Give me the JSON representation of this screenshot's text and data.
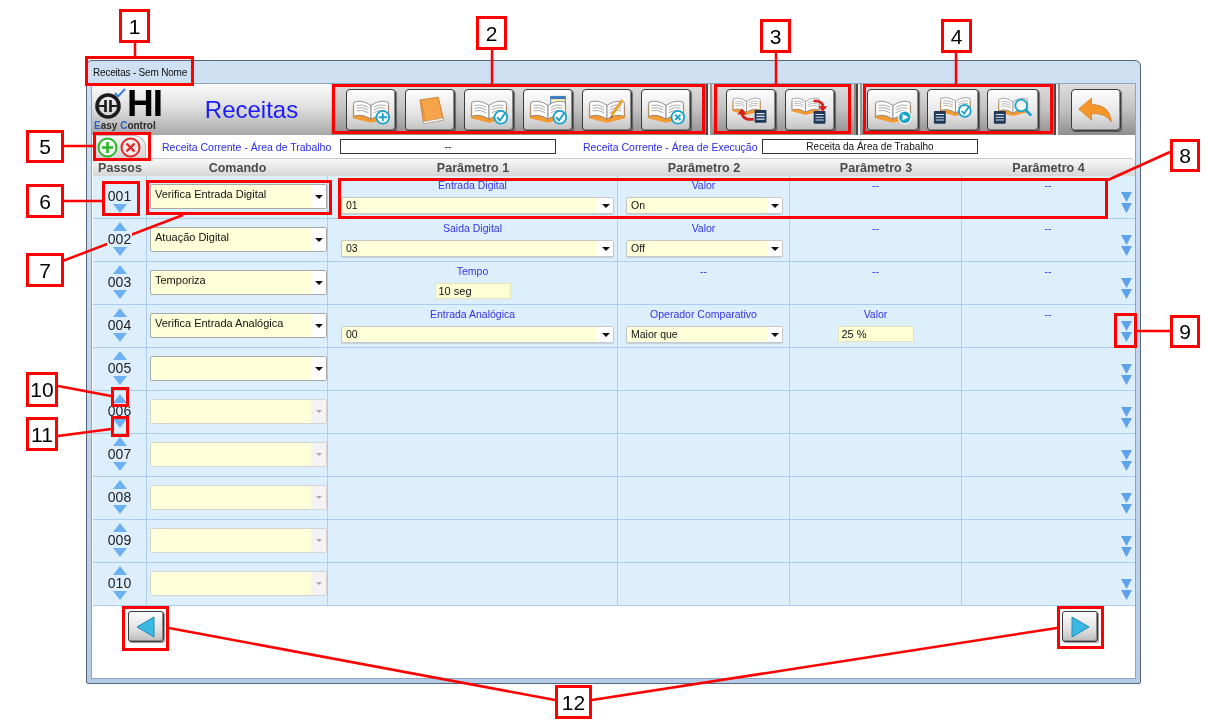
{
  "window": {
    "title": "Receitas - Sem Nome"
  },
  "header": {
    "logo": {
      "mark": "HI",
      "tagline": "Easy Control"
    },
    "title": "Receitas"
  },
  "recipe_bar": {
    "work_area": {
      "label": "Receita Corrente - Área de Trabalho",
      "value": "--"
    },
    "execution_area": {
      "label": "Receita Corrente - Área de Execução",
      "value": "Receita da Área de Trabalho"
    }
  },
  "table": {
    "columns": [
      "Passos",
      "Comando",
      "Parâmetro 1",
      "Parâmetro 2",
      "Parâmetro 3",
      "Parâmetro 4"
    ],
    "rows": [
      {
        "step": "001",
        "can_move_up": false,
        "command": "Verifica Entrada Digital",
        "command_disabled": false,
        "params": [
          {
            "kind": "select",
            "label": "Entrada Digital",
            "value": "01"
          },
          {
            "kind": "select",
            "label": "Valor",
            "value": "On"
          },
          {
            "kind": "none",
            "label": "--"
          },
          {
            "kind": "none",
            "label": "--"
          }
        ]
      },
      {
        "step": "002",
        "can_move_up": true,
        "command": "Atuação Digital",
        "command_disabled": false,
        "params": [
          {
            "kind": "select",
            "label": "Saida Digital",
            "value": "03"
          },
          {
            "kind": "select",
            "label": "Valor",
            "value": "Off"
          },
          {
            "kind": "none",
            "label": "--"
          },
          {
            "kind": "none",
            "label": "--"
          }
        ]
      },
      {
        "step": "003",
        "can_move_up": true,
        "command": "Temporiza",
        "command_disabled": false,
        "params": [
          {
            "kind": "text",
            "label": "Tempo",
            "value": "10 seg"
          },
          {
            "kind": "none",
            "label": "--"
          },
          {
            "kind": "none",
            "label": "--"
          },
          {
            "kind": "none",
            "label": "--"
          }
        ]
      },
      {
        "step": "004",
        "can_move_up": true,
        "command": "Verifica Entrada Analógica",
        "command_disabled": false,
        "params": [
          {
            "kind": "select",
            "label": "Entrada Analógica",
            "value": "00"
          },
          {
            "kind": "select",
            "label": "Operador Comparativo",
            "value": "Maior que"
          },
          {
            "kind": "text",
            "label": "Valor",
            "value": "25 %"
          },
          {
            "kind": "none",
            "label": "--"
          }
        ]
      },
      {
        "step": "005",
        "can_move_up": true,
        "command_disabled": false
      },
      {
        "step": "006",
        "can_move_up": true,
        "command_disabled": true
      },
      {
        "step": "007",
        "can_move_up": true,
        "command_disabled": true
      },
      {
        "step": "008",
        "can_move_up": true,
        "command_disabled": true
      },
      {
        "step": "009",
        "can_move_up": true,
        "command_disabled": true
      },
      {
        "step": "010",
        "can_move_up": true,
        "command_disabled": true
      }
    ]
  },
  "annotations": [
    {
      "label": "1"
    },
    {
      "label": "2"
    },
    {
      "label": "3"
    },
    {
      "label": "4"
    },
    {
      "label": "5"
    },
    {
      "label": "6"
    },
    {
      "label": "7"
    },
    {
      "label": "8"
    },
    {
      "label": "9"
    },
    {
      "label": "10"
    },
    {
      "label": "11"
    },
    {
      "label": "12"
    }
  ]
}
